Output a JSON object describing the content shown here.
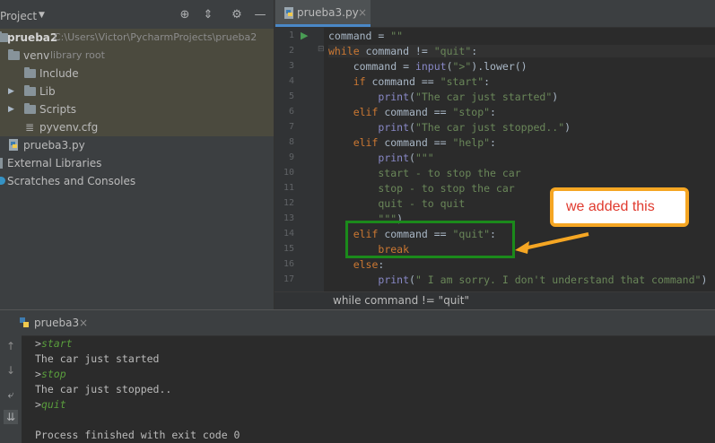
{
  "project_panel": {
    "title": "Project",
    "tree": [
      {
        "label": "prueba2",
        "path": "C:\\Users\\Victor\\PycharmProjects\\prueba2"
      },
      {
        "label": "venv",
        "note": "library root"
      },
      {
        "label": "Include"
      },
      {
        "label": "Lib"
      },
      {
        "label": "Scripts"
      },
      {
        "label": "pyvenv.cfg"
      },
      {
        "label": "prueba3.py"
      },
      {
        "label": "External Libraries"
      },
      {
        "label": "Scratches and Consoles"
      }
    ]
  },
  "editor": {
    "tab_label": "prueba3.py",
    "close_glyph": "×",
    "line_numbers": [
      "1",
      "2",
      "3",
      "4",
      "5",
      "6",
      "7",
      "8",
      "9",
      "10",
      "11",
      "12",
      "13",
      "14",
      "15",
      "16",
      "17"
    ],
    "breadcrumb": "while command != \"quit\""
  },
  "run_panel": {
    "tab_label": "prueba3",
    "close_glyph": "×",
    "console": [
      {
        "prompt": ">",
        "input": "start"
      },
      {
        "text": "The car just started"
      },
      {
        "prompt": ">",
        "input": "stop"
      },
      {
        "text": "The car just stopped.."
      },
      {
        "prompt": ">",
        "input": "quit"
      },
      {
        "text": ""
      },
      {
        "text": "Process finished with exit code 0"
      }
    ]
  },
  "annotation": {
    "callout_text": "we added this",
    "box_color": "#1b8a1b",
    "callout_border_color": "#f5a623",
    "callout_text_color": "#e03a2e"
  },
  "colors": {
    "keyword": "#cc7832",
    "string": "#6a8759",
    "builtin": "#8888c6",
    "text": "#a9b7c6",
    "selection_bg": "#4b4a3e"
  }
}
